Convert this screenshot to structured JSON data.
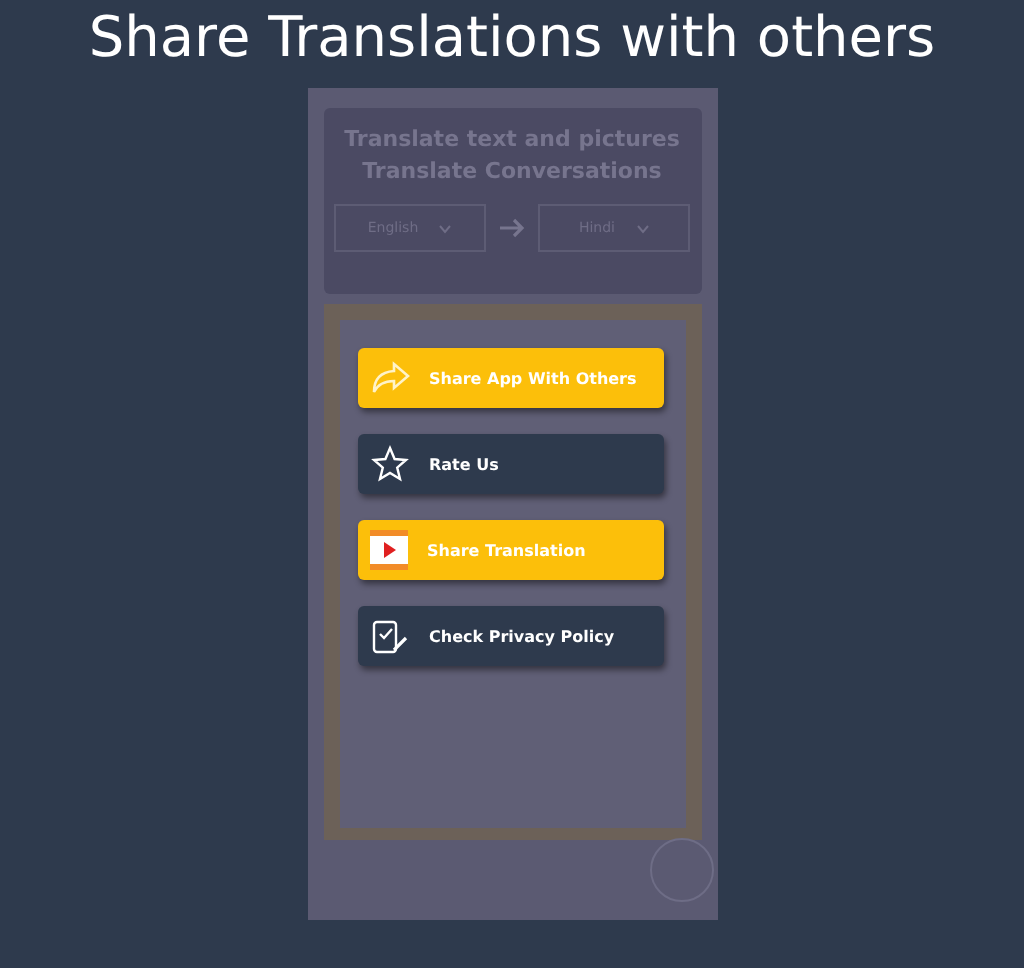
{
  "title": "Share Translations with others",
  "header": {
    "line_1": "Translate text and pictures",
    "line_2": "Translate Conversations",
    "source_language": "English",
    "target_language": "Hindi"
  },
  "menu": [
    {
      "label": "Share App With Others",
      "kind": "share",
      "color": "#fcbf0a"
    },
    {
      "label": "Rate Us",
      "kind": "star",
      "color": "#2e3a4d"
    },
    {
      "label": "Share Translation",
      "kind": "video",
      "color": "#fcbf0a"
    },
    {
      "label": "Check Privacy Policy",
      "kind": "policy",
      "color": "#2e3a4d"
    }
  ]
}
